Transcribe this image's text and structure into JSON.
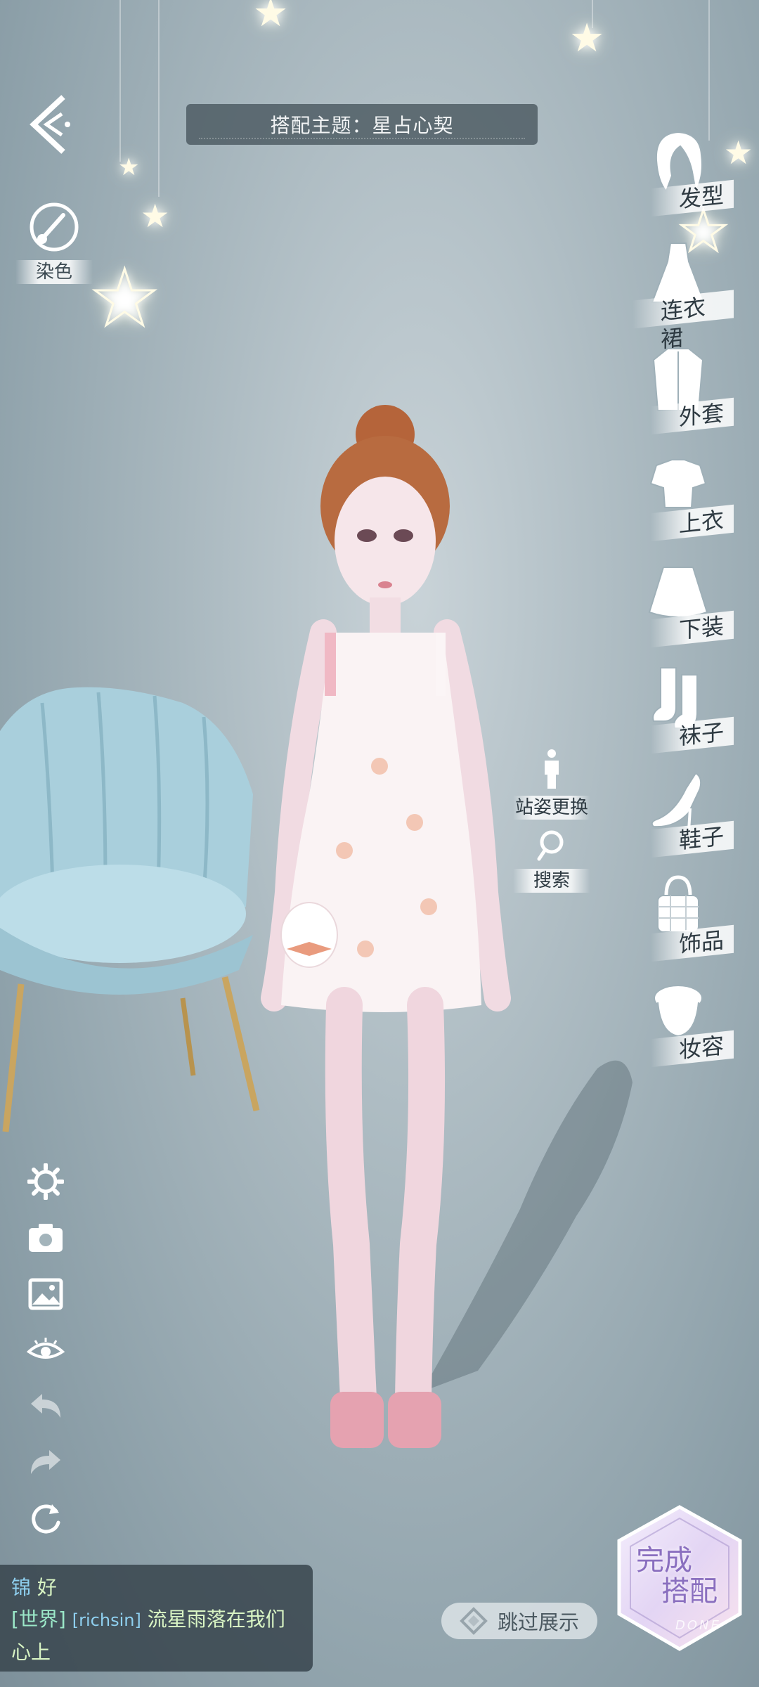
{
  "header": {
    "theme_text": "搭配主题：星占心契"
  },
  "left_top": {
    "dye_label": "染色"
  },
  "categories": [
    {
      "label": "发型",
      "icon": "hair-icon"
    },
    {
      "label": "连衣裙",
      "icon": "dress-icon"
    },
    {
      "label": "外套",
      "icon": "coat-icon"
    },
    {
      "label": "上衣",
      "icon": "top-icon"
    },
    {
      "label": "下装",
      "icon": "skirt-icon"
    },
    {
      "label": "袜子",
      "icon": "socks-icon"
    },
    {
      "label": "鞋子",
      "icon": "shoe-icon"
    },
    {
      "label": "饰品",
      "icon": "bag-icon"
    },
    {
      "label": "妆容",
      "icon": "makeup-icon"
    }
  ],
  "mid": {
    "pose_label": "站姿更换",
    "search_label": "搜索"
  },
  "tools": [
    "gear-icon",
    "camera-icon",
    "image-icon",
    "eye-icon",
    "undo-icon",
    "redo-icon",
    "reset-icon"
  ],
  "chat": {
    "line1_name": "锦",
    "line1_msg": "好",
    "channel": "[世界]",
    "user": "[richsin]",
    "message": "流星雨落在我们",
    "message_cont": "心上"
  },
  "skip_label": "跳过展示",
  "done": {
    "line1": "完成",
    "line2": "搭配",
    "sub": "DONE"
  },
  "colors": {
    "background": "#a9b8bf",
    "accent_done": "#8a6fbf",
    "chat_bg": "#37444c"
  }
}
